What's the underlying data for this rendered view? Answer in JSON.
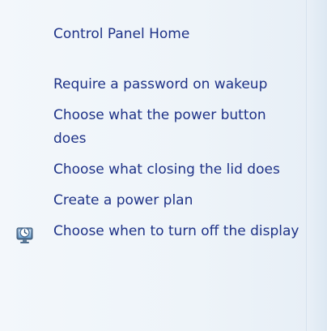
{
  "sidebar": {
    "items": [
      {
        "label": "Control Panel Home"
      },
      {
        "label": "Require a password on wakeup"
      },
      {
        "label": "Choose what the power button does"
      },
      {
        "label": "Choose what closing the lid does"
      },
      {
        "label": "Create a power plan"
      },
      {
        "label": "Choose when to turn off the display",
        "icon": "display-timer-icon"
      }
    ]
  }
}
